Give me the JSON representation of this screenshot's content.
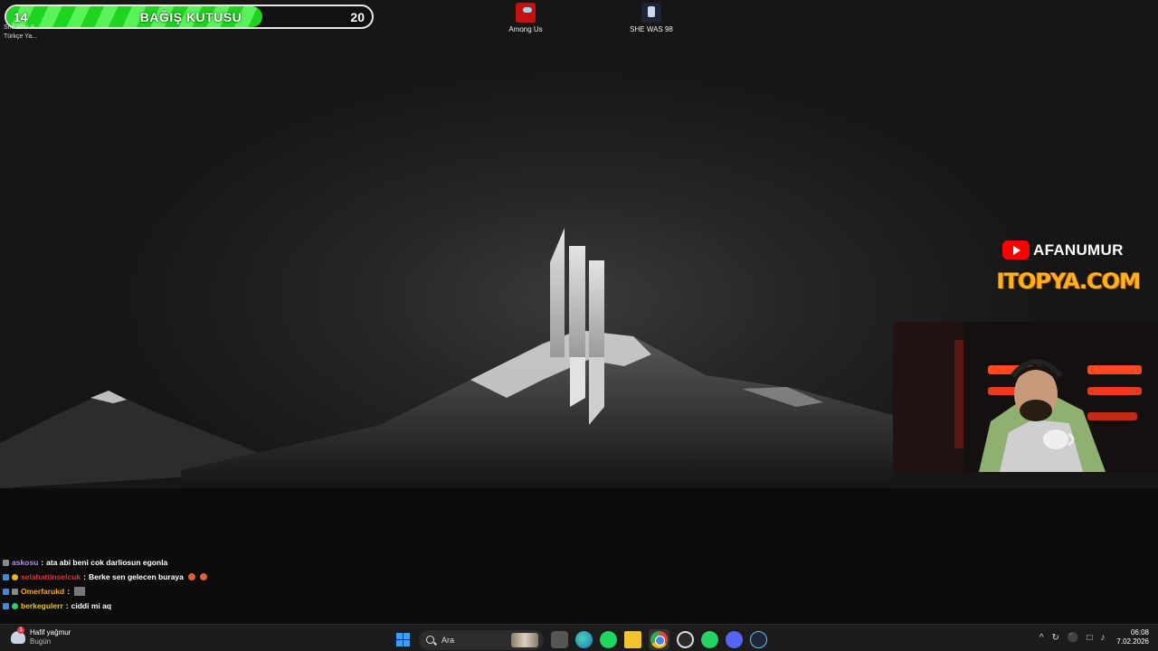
{
  "donation": {
    "title": "BAĞIŞ KUTUSU",
    "current": "14",
    "goal": "20",
    "progress_fraction": 0.7
  },
  "desktop_corner": {
    "line1": "She Was 9...",
    "line2": "Türkçe Ya..."
  },
  "desktop_icons": [
    {
      "label": "Among Us",
      "icon": "among-us-icon"
    },
    {
      "label": "SHE WAS 98",
      "icon": "she-was-98-icon"
    }
  ],
  "overlay": {
    "channel": "AFANUMUR",
    "sponsor": "ITOPYA.COM"
  },
  "chat": [
    {
      "user": "askosu",
      "user_color": "#b389f5",
      "message": "ata abi beni cok darliosun egonla"
    },
    {
      "user": "selahattinselcuk",
      "user_color": "#e0303a",
      "message": "Berke sen gelecen buraya"
    },
    {
      "user": "Omerfarukd",
      "user_color": "#f5a623",
      "message": ""
    },
    {
      "user": "berkegulerr",
      "user_color": "#f0c419",
      "message": "ciddi mi aq"
    }
  ],
  "taskbar": {
    "weather": {
      "condition": "Hafif yağmur",
      "day": "Bugün"
    },
    "search_placeholder": "Ara",
    "time": "06:08",
    "date": "7.02.2026"
  },
  "colors": {
    "donation_fill": "#1ed41e",
    "sponsor": "#ffb21e",
    "youtube": "#ff0000"
  }
}
